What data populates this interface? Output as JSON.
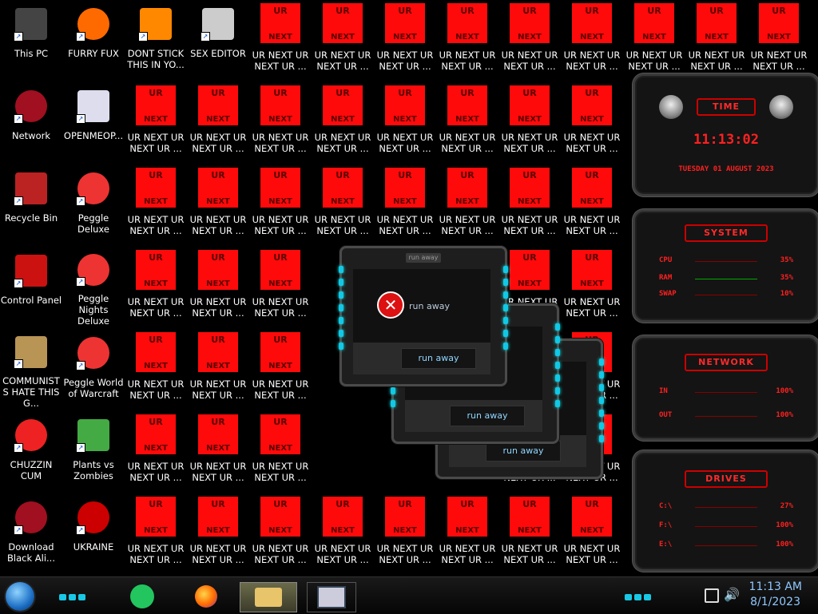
{
  "desktop": {
    "col0": [
      {
        "label": "This PC",
        "icon": "computer-icon"
      },
      {
        "label": "Network",
        "icon": "network-icon"
      },
      {
        "label": "Recycle Bin",
        "icon": "recycle-bin-icon"
      },
      {
        "label": "Control Panel",
        "icon": "control-panel-icon"
      },
      {
        "label": "COMMUNISTS HATE THIS G...",
        "icon": "money-bag-icon"
      },
      {
        "label": "CHUZZIN CUM",
        "icon": "chuzzle-icon"
      },
      {
        "label": "Download Black Ali...",
        "icon": "alienware-icon"
      }
    ],
    "col1": [
      {
        "label": "FURRY FUX",
        "icon": "firefox-icon"
      },
      {
        "label": "OPENMEOP...",
        "icon": "document-icon"
      },
      {
        "label": "Peggle Deluxe",
        "icon": "peggle-icon"
      },
      {
        "label": "Peggle Nights Deluxe",
        "icon": "peggle-icon"
      },
      {
        "label": "Peggle World of Warcraft",
        "icon": "peggle-icon"
      },
      {
        "label": "Plants vs Zombies",
        "icon": "pvz-icon"
      },
      {
        "label": "UKRAINE",
        "icon": "radiation-icon"
      }
    ],
    "col2_row0": {
      "label": "DONT STICK THIS IN YO...",
      "icon": "vlc-icon"
    },
    "col3_row0": {
      "label": "SEX EDITOR",
      "icon": "hxd-icon"
    },
    "ur_tile": {
      "top": "UR",
      "bottom": "NEXT",
      "label": "UR NEXT UR NEXT UR ..."
    }
  },
  "gadget": {
    "time_title": "TIME",
    "time": "11:13:02",
    "date": "TUESDAY 01 AUGUST 2023",
    "system_title": "SYSTEM",
    "system": [
      {
        "k": "CPU",
        "v": "35%"
      },
      {
        "k": "RAM",
        "v": "35%"
      },
      {
        "k": "SWAP",
        "v": "10%"
      }
    ],
    "network_title": "NETWORK",
    "network": [
      {
        "k": "IN",
        "v": "100%"
      },
      {
        "k": "OUT",
        "v": "100%"
      }
    ],
    "drives_title": "DRIVES",
    "drives": [
      {
        "k": "C:\\",
        "v": "27%"
      },
      {
        "k": "F:\\",
        "v": "100%"
      },
      {
        "k": "E:\\",
        "v": "100%"
      }
    ]
  },
  "dialogs": [
    {
      "title": "run away",
      "message": "run away",
      "button": "run away"
    },
    {
      "title": "run away",
      "message": "",
      "button": "run away"
    },
    {
      "title": "run away",
      "message": "",
      "button": "run away"
    }
  ],
  "taskbar": {
    "time": "11:13 AM",
    "date": "8/1/2023"
  },
  "colors": {
    "tile": "#ff0a0a",
    "accent": "#17c9e6",
    "gadget_red": "#ff2020",
    "clock": "#8fc8ff"
  }
}
